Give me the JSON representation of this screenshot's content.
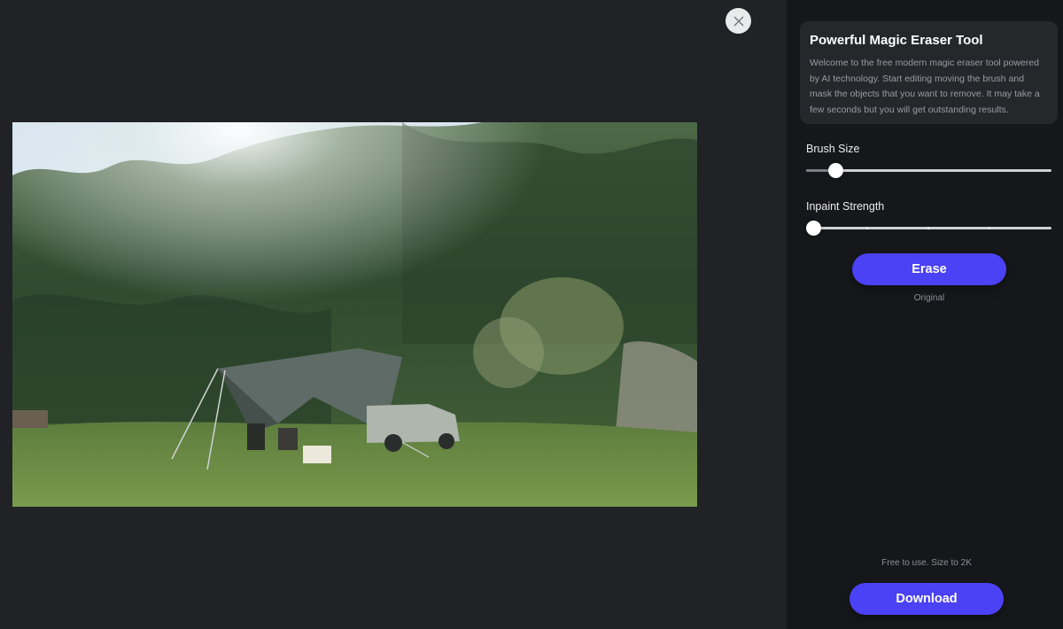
{
  "info": {
    "title": "Powerful Magic Eraser Tool",
    "description": "Welcome to the free modern magic eraser tool powered by AI technology. Start editing moving the brush and mask the objects that you want to remove. It may take a few seconds but you will get outstanding results."
  },
  "brush_size": {
    "label": "Brush Size",
    "value_fraction": 0.12
  },
  "inpaint_strength": {
    "label": "Inpaint Strength",
    "value_fraction": 0.0
  },
  "erase_button": {
    "label": "Erase"
  },
  "original_label": "Original",
  "footer": {
    "note": "Free to use. Size to 2K",
    "download_label": "Download"
  },
  "colors": {
    "accent": "#4b41f5",
    "panel_bg": "#16171a",
    "canvas_bg": "#202226"
  },
  "icons": {
    "close": "close-icon"
  }
}
